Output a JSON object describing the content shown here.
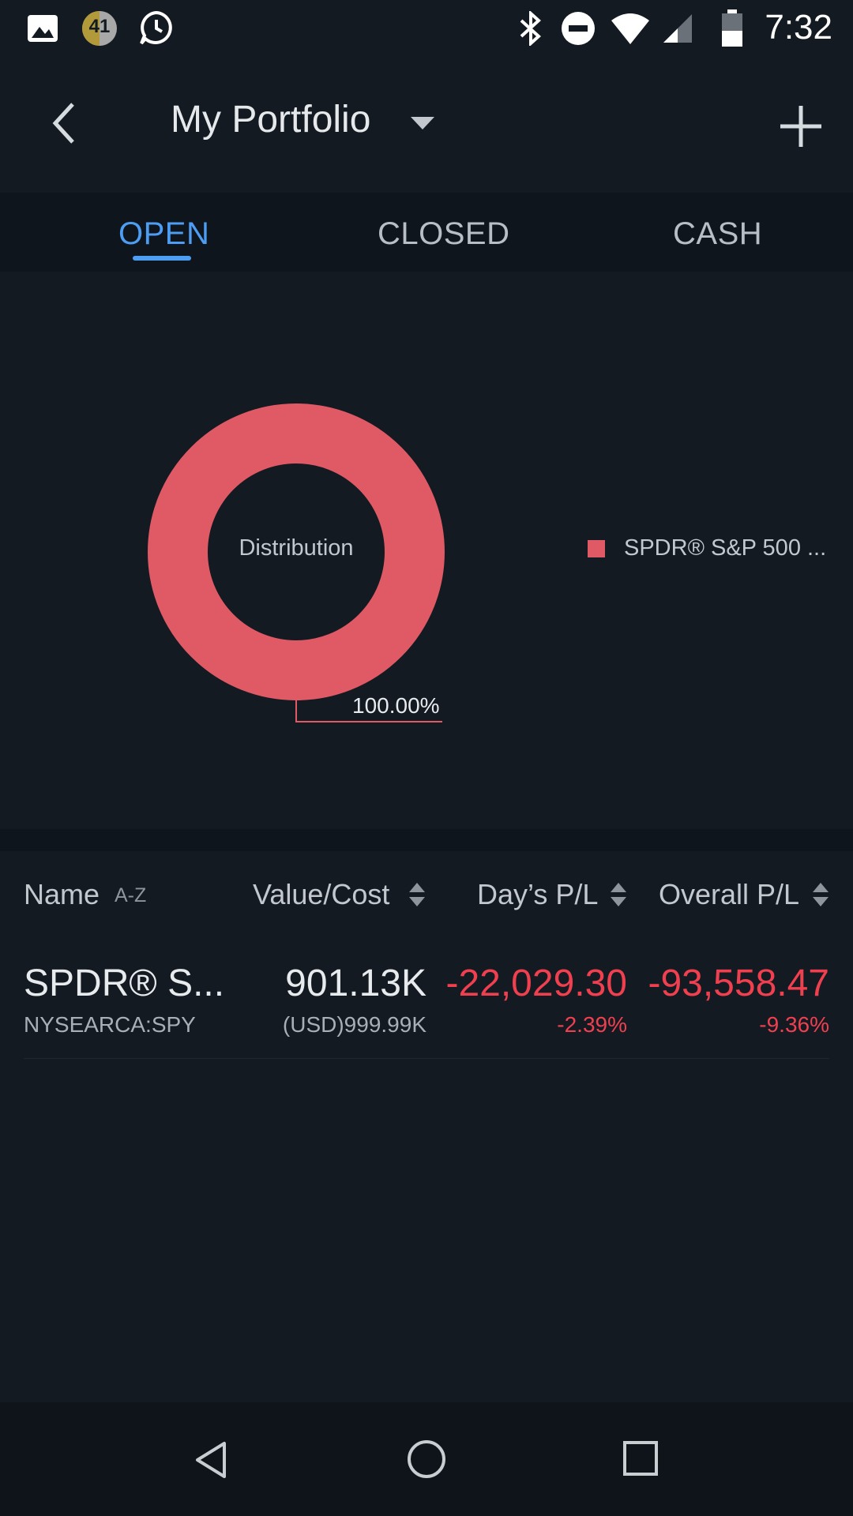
{
  "status_bar": {
    "time": "7:32",
    "notification_badge": "41",
    "left_icons": [
      "image-icon",
      "badge-41-icon",
      "clock-message-icon"
    ],
    "right_icons": [
      "bluetooth-icon",
      "do-not-disturb-icon",
      "wifi-icon",
      "cell-signal-icon",
      "battery-icon"
    ]
  },
  "app_bar": {
    "title": "My Portfolio",
    "back_icon": "chevron-left-icon",
    "dropdown_icon": "triangle-down-icon",
    "add_icon": "plus-icon"
  },
  "tabs": [
    {
      "label": "OPEN",
      "active": true
    },
    {
      "label": "CLOSED",
      "active": false
    },
    {
      "label": "CASH",
      "active": false
    }
  ],
  "chart": {
    "center_label": "Distribution",
    "legend": "SPDR® S&P 500 ...",
    "percent_label": "100.00%"
  },
  "chart_data": {
    "type": "pie",
    "style": "donut",
    "categories": [
      "SPDR® S&P 500 ..."
    ],
    "values": [
      100.0
    ],
    "labels": [
      "100.00%"
    ],
    "colors": [
      "#e05a66"
    ],
    "center_text": "Distribution",
    "legend_position": "right"
  },
  "table": {
    "headers": {
      "name": "Name",
      "name_sort": "A-Z",
      "value_cost": "Value/Cost",
      "days_pl": "Day’s P/L",
      "overall_pl": "Overall P/L"
    },
    "rows": [
      {
        "name": "SPDR® S...",
        "ticker": "NYSEARCA:SPY",
        "value": "901.13K",
        "cost": "(USD)999.99K",
        "days_pl": "-22,029.30",
        "days_pl_pct": "-2.39%",
        "overall_pl": "-93,558.47",
        "overall_pl_pct": "-9.36%"
      }
    ]
  },
  "nav_bar": {
    "icons": [
      "back-triangle-icon",
      "home-circle-icon",
      "recents-square-icon"
    ]
  },
  "colors": {
    "accent": "#4d9df2",
    "negative": "#f0404f",
    "chart_slice": "#e05a66",
    "background": "#131a22"
  }
}
